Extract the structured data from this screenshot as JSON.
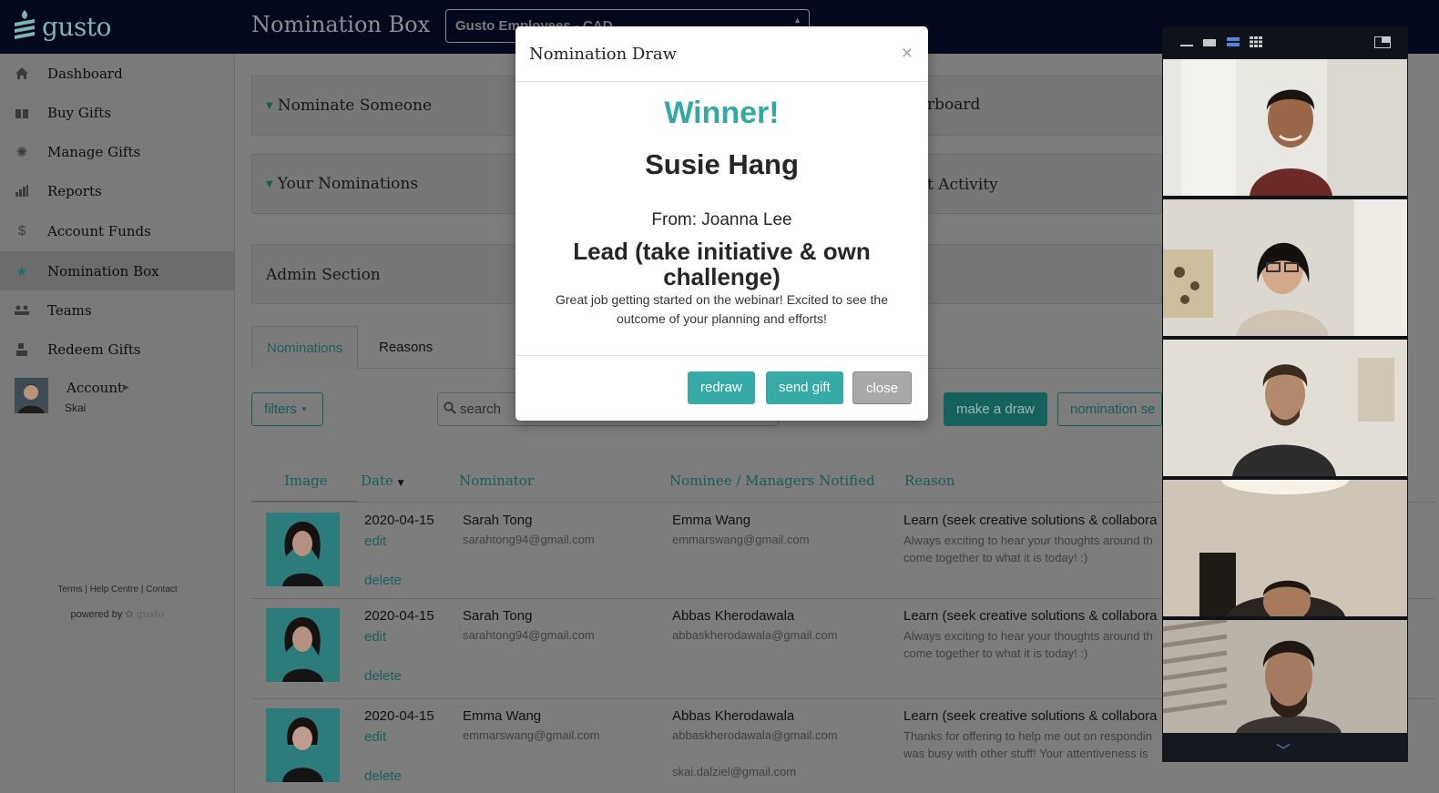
{
  "app": {
    "logo_text": "gusto",
    "page_title": "Nomination Box",
    "group_select_value": "Gusto Employees - CAD"
  },
  "sidebar": {
    "items": [
      {
        "label": "Dashboard",
        "icon": "home-icon"
      },
      {
        "label": "Buy Gifts",
        "icon": "gift-icon"
      },
      {
        "label": "Manage Gifts",
        "icon": "gear-icon"
      },
      {
        "label": "Reports",
        "icon": "bar-chart-icon"
      },
      {
        "label": "Account Funds",
        "icon": "dollar-icon"
      },
      {
        "label": "Nomination Box",
        "icon": "star-icon"
      },
      {
        "label": "Teams",
        "icon": "group-icon"
      },
      {
        "label": "Redeem Gifts",
        "icon": "redeem-icon"
      }
    ],
    "account_label": "Account",
    "account_user": "Skai",
    "footer_links": "Terms | Help Centre | Contact",
    "powered_by": "powered by",
    "powered_brand": "gusto"
  },
  "panels": {
    "nominate": "Nominate Someone",
    "your_nominations": "Your Nominations",
    "admin": "Admin Section",
    "leaderboard_partial": "rboard",
    "activity_partial": "t Activity"
  },
  "tabs": [
    "Nominations",
    "Reasons"
  ],
  "toolbar": {
    "filters": "filters",
    "search_placeholder": "search",
    "make_draw": "make a draw",
    "nomination_settings": "nomination se"
  },
  "table": {
    "headers": {
      "image": "Image",
      "date": "Date",
      "nominator": "Nominator",
      "nominee": "Nominee / Managers Notified",
      "reason": "Reason"
    },
    "rows": [
      {
        "date": "2020-04-15",
        "edit": "edit",
        "delete": "delete",
        "nominator": "Sarah Tong",
        "nominator_email": "sarahtong94@gmail.com",
        "nominee": "Emma Wang",
        "nominee_email": "emmarswang@gmail.com",
        "manager_email": "",
        "reason": "Learn (seek creative solutions & collabora",
        "message_1": "Always exciting to hear your thoughts around th",
        "message_2": "come together to what it is today! :)"
      },
      {
        "date": "2020-04-15",
        "edit": "edit",
        "delete": "delete",
        "nominator": "Sarah Tong",
        "nominator_email": "sarahtong94@gmail.com",
        "nominee": "Abbas Kherodawala",
        "nominee_email": "abbaskherodawala@gmail.com",
        "manager_email": "",
        "reason": "Learn (seek creative solutions & collabora",
        "message_1": "Always exciting to hear your thoughts around th",
        "message_2": "come together to what it is today! :)"
      },
      {
        "date": "2020-04-15",
        "edit": "edit",
        "delete": "delete",
        "nominator": "Emma Wang",
        "nominator_email": "emmarswang@gmail.com",
        "nominee": "Abbas Kherodawala",
        "nominee_email": "abbaskherodawala@gmail.com",
        "manager_email": "skai.dalziel@gmail.com",
        "reason": "Learn (seek creative solutions & collabora",
        "message_1": "Thanks for offering to help me out on respondin",
        "message_2": "was busy with other stuff! Your attentiveness is"
      }
    ]
  },
  "modal": {
    "title": "Nomination Draw",
    "close_glyph": "×",
    "winner_heading": "Winner!",
    "winner_name": "Susie Hang",
    "from_line": "From: Joanna Lee",
    "reason": "Lead (take initiative & own challenge)",
    "message": "Great job getting started on the webinar! Excited to see the outcome of your planning and efforts!",
    "buttons": {
      "redraw": "redraw",
      "send_gift": "send gift",
      "close": "close"
    }
  },
  "colors": {
    "accent": "#36aaa5",
    "topbar": "#05091d",
    "overlay_gray": "#7d7d7d"
  }
}
